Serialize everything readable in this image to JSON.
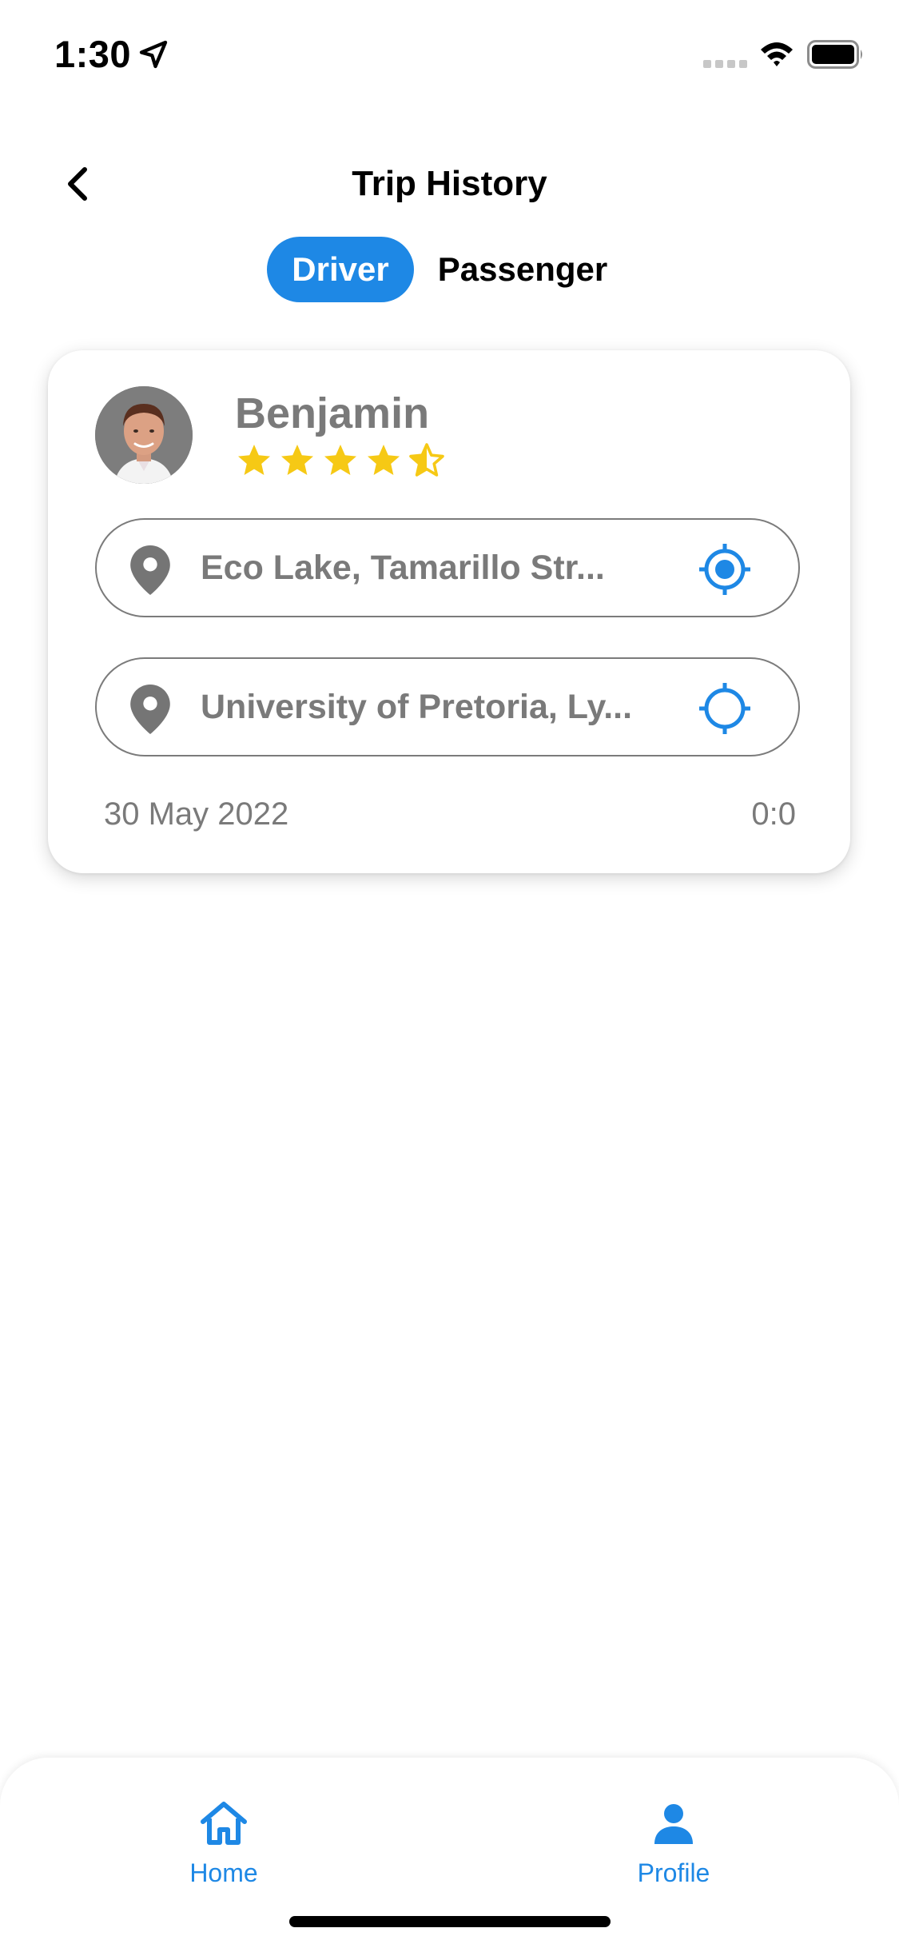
{
  "status_bar": {
    "time": "1:30"
  },
  "header": {
    "title": "Trip History"
  },
  "tabs": {
    "selected": "Driver",
    "items": [
      "Driver",
      "Passenger"
    ]
  },
  "trip": {
    "name": "Benjamin",
    "rating": 4.5,
    "rating_max": 5,
    "from": "Eco Lake, Tamarillo Str...",
    "to": "University of Pretoria, Ly...",
    "date": "30 May 2022",
    "duration": "0:0"
  },
  "bottom_nav": {
    "home_label": "Home",
    "profile_label": "Profile"
  },
  "colors": {
    "accent": "#1e88e5",
    "star": "#f6c915",
    "muted_text": "#7a7a7a"
  }
}
